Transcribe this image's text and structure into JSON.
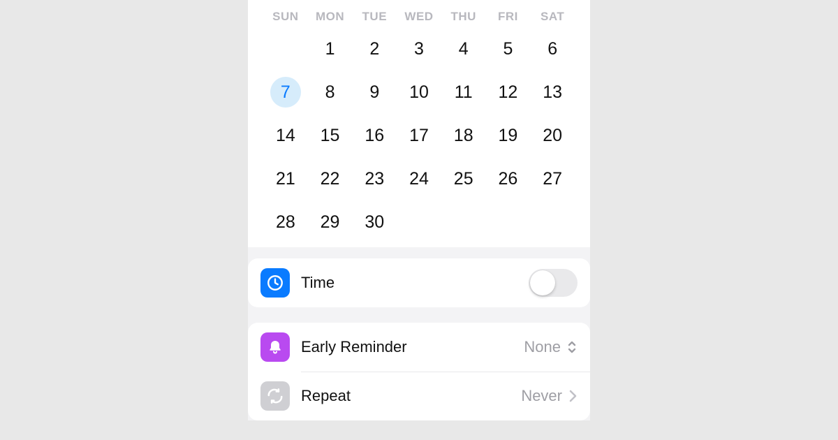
{
  "calendar": {
    "weekdays": [
      "SUN",
      "MON",
      "TUE",
      "WED",
      "THU",
      "FRI",
      "SAT"
    ],
    "leading_blanks": 1,
    "days_in_month": 30,
    "selected_day": 7
  },
  "time": {
    "label": "Time",
    "enabled": false
  },
  "early_reminder": {
    "label": "Early Reminder",
    "value": "None"
  },
  "repeat": {
    "label": "Repeat",
    "value": "Never"
  },
  "colors": {
    "accent_blue": "#0a7bff",
    "accent_purple": "#b94af0",
    "icon_gray": "#cfcfd3",
    "selected_bg": "#d6ecfb"
  }
}
